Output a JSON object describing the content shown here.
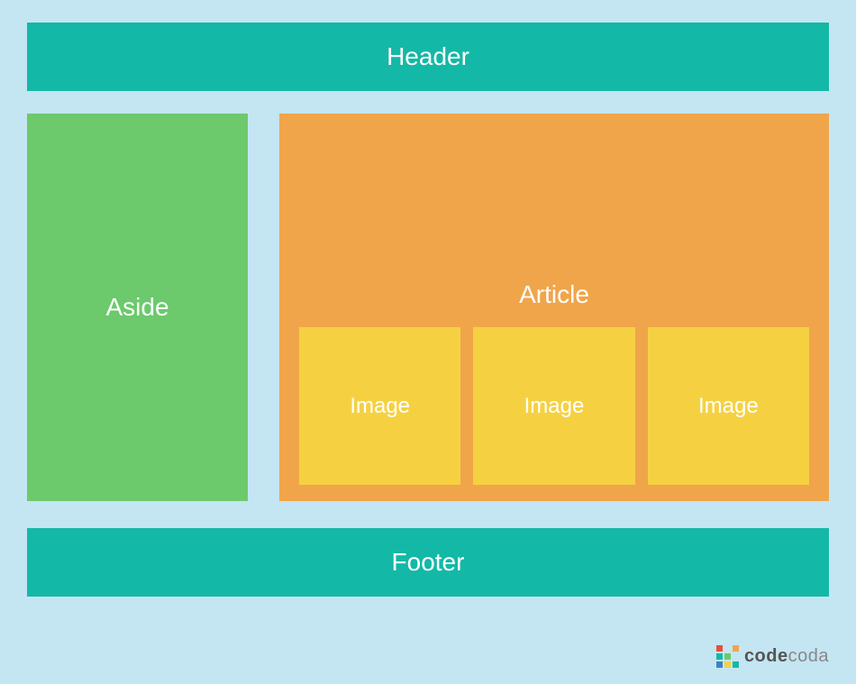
{
  "layout": {
    "header": "Header",
    "aside": "Aside",
    "article": "Article",
    "images": [
      "Image",
      "Image",
      "Image"
    ],
    "footer": "Footer"
  },
  "colors": {
    "background": "#c4e5f2",
    "header_footer": "#14b8a6",
    "aside": "#6cc96c",
    "article": "#f0a54a",
    "image": "#f5d142",
    "text": "#ffffff"
  },
  "logo": {
    "prefix": "code",
    "suffix": "coda",
    "cells": [
      {
        "color": "#e94e3a"
      },
      {
        "color": "transparent"
      },
      {
        "color": "#f0a54a"
      },
      {
        "color": "#14b8a6"
      },
      {
        "color": "#6cc96c"
      },
      {
        "color": "transparent"
      },
      {
        "color": "#3b82c4"
      },
      {
        "color": "#f5d142"
      },
      {
        "color": "#14b8a6"
      }
    ]
  }
}
